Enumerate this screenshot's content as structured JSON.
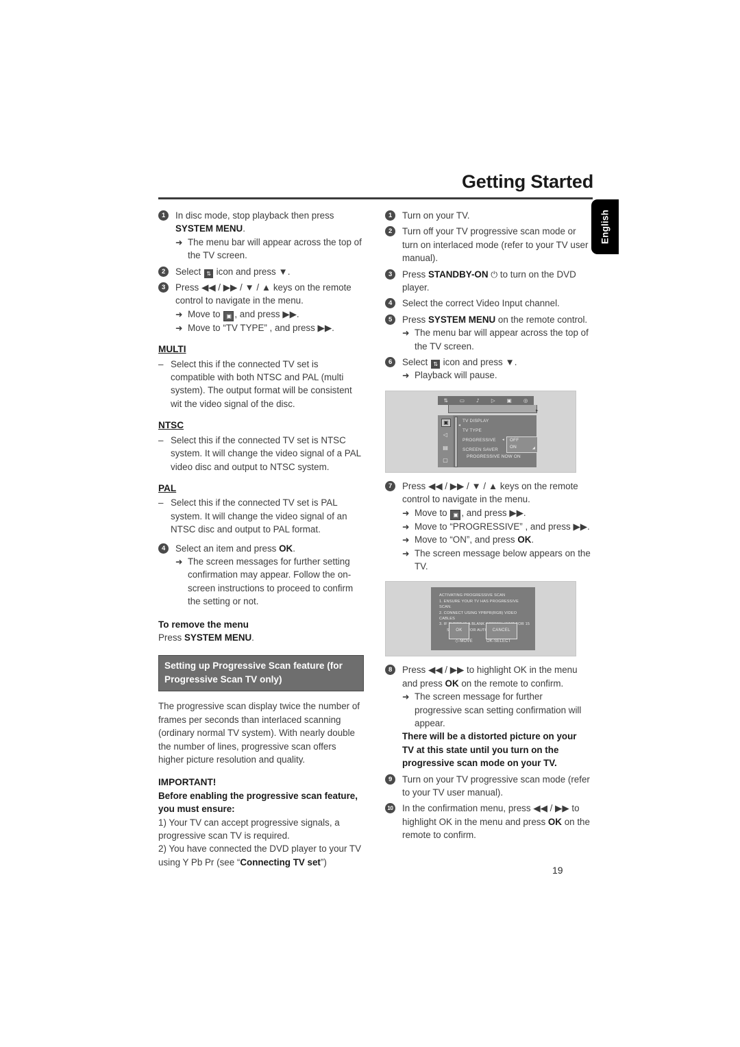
{
  "header": {
    "title": "Getting Started",
    "side_tab": "English"
  },
  "page_number": "19",
  "left_column": {
    "step1": {
      "num": "1",
      "text_a": "In disc mode, stop playback then press ",
      "bold_b": "SYSTEM MENU",
      "text_c": ".",
      "bullet": "The menu bar will appear across the top of the TV screen."
    },
    "step2": {
      "num": "2",
      "text_a": "Select ",
      "icon": "settings-icon",
      "text_b": " icon and press ▼."
    },
    "step3": {
      "num": "3",
      "text_a": "Press ◀◀ / ▶▶  /  ▼  /  ▲  keys on the remote control to navigate in the menu.",
      "bullet1_a": "Move to ",
      "bullet1_icon": "tv-display-icon",
      "bullet1_b": ", and press ▶▶.",
      "bullet2": "Move to “TV TYPE” , and press ▶▶."
    },
    "multi": {
      "heading": "MULTI",
      "body": "Select this if the connected TV set is compatible with both NTSC and PAL (multi system). The output format will be consistent wit the video signal of the disc."
    },
    "ntsc": {
      "heading": "NTSC",
      "body": "Select this if the connected TV set is NTSC system. It will change the video signal of a PAL video disc and output to NTSC system."
    },
    "pal": {
      "heading": "PAL",
      "body": "Select this if the connected TV set is PAL system. It will change the video signal of an NTSC disc and output to PAL format."
    },
    "step4": {
      "num": "4",
      "text_a": "Select an item and press ",
      "bold_b": "OK",
      "text_c": ".",
      "bullet": "The screen messages for further setting confirmation may appear. Follow the on-screen instructions to proceed to confirm the setting or not."
    },
    "remove_menu": {
      "heading": "To remove the menu",
      "text_a": "Press ",
      "bold_b": "SYSTEM MENU",
      "text_c": "."
    },
    "banner": "Setting up Progressive Scan feature (for Progressive Scan TV only)",
    "intro": "The progressive scan display twice the number of frames per seconds than interlaced scanning (ordinary normal TV system). With nearly double the number of lines, progressive scan offers higher picture resolution and quality.",
    "important": {
      "heading": "IMPORTANT!",
      "subheading": "Before enabling the progressive scan feature, you must ensure:",
      "item1": "1) Your TV can accept progressive signals, a progressive scan TV is required.",
      "item2_a": "2) You have connected the DVD player to your TV using Y Pb Pr (see “",
      "item2_bold": "Connecting TV set",
      "item2_c": "”)"
    }
  },
  "right_column": {
    "step1": {
      "num": "1",
      "text": "Turn on your TV."
    },
    "step2": {
      "num": "2",
      "text": "Turn off your TV progressive scan mode or turn on interlaced mode (refer to your TV user manual)."
    },
    "step3": {
      "num": "3",
      "text_a": "Press ",
      "bold_b": "STANDBY-ON",
      "icon": "power-icon",
      "text_c": " to turn on the DVD player."
    },
    "step4": {
      "num": "4",
      "text": "Select the correct Video Input channel."
    },
    "step5": {
      "num": "5",
      "text_a": "Press ",
      "bold_b": "SYSTEM MENU",
      "text_c": " on the remote control.",
      "bullet": "The menu bar will appear across the top of the TV screen."
    },
    "step6": {
      "num": "6",
      "text_a": "Select ",
      "icon": "settings-icon",
      "text_b": " icon and press ▼.",
      "bullet": "Playback will pause."
    },
    "step7": {
      "num": "7",
      "text_a": "Press ◀◀ / ▶▶  /  ▼  /  ▲  keys on the remote control to navigate in the menu.",
      "bullet1_a": "Move to ",
      "bullet1_icon": "tv-display-icon",
      "bullet1_b": ", and press ▶▶.",
      "bullet2": "Move to “PROGRESSIVE” , and press ▶▶.",
      "bullet3_a": "Move to “ON”,  and press ",
      "bullet3_bold": "OK",
      "bullet3_c": ".",
      "bullet4": "The screen message below appears on the TV."
    },
    "step8": {
      "num": "8",
      "text_a": "Press ◀◀ / ▶▶  to highlight OK in the menu and press ",
      "bold_b": "OK",
      "text_c": " on the remote to confirm.",
      "bullet": "The screen message for further progressive scan setting confirmation will appear.",
      "warning": "There will be a distorted picture on your TV at this state until you turn on the progressive scan mode on your TV."
    },
    "step9": {
      "num": "9",
      "text": "Turn on your TV progressive scan mode (refer to your TV user manual)."
    },
    "step10": {
      "num": "10",
      "text_a": "In the confirmation menu, press ◀◀ / ▶▶  to highlight OK in the menu and press ",
      "bold_b": "OK",
      "text_c": " on the remote to confirm."
    }
  },
  "screenshot_menu": {
    "menubar_icons": [
      "settings-icon",
      "tv-display-icon",
      "sound-icon",
      "playback-icon",
      "video-icon",
      "preference-icon"
    ],
    "rail_icons": [
      "tv-display-icon",
      "sound-icon",
      "subtitle-icon",
      "lock-icon"
    ],
    "items": [
      "TV DISPLAY",
      "TV TYPE",
      "PROGRESSIVE",
      "SCREEN SAVER"
    ],
    "dropdown_options": [
      "OFF",
      "ON"
    ],
    "status": "PROGRESSIVE NOW ON"
  },
  "screenshot_dialog": {
    "title": "ACTIVATING  PROGRESSIVE SCAN",
    "line1": "1.  ENSURE YOUR TV HAS PROGRESSIVE SCAN.",
    "line2": "2.  CONNECT USING YPBPR(RGB) VIDEO CABLES",
    "line3": "3.  IF THERE IS A BLANK SCREEN, WAIT FOR 15",
    "line3b": "SECONDS FOR AUTO RECOVER.",
    "ok_button": "OK",
    "cancel_button": "CANCEL",
    "hint_move": "◇-MOVE",
    "hint_select": "OK-SELECT"
  }
}
